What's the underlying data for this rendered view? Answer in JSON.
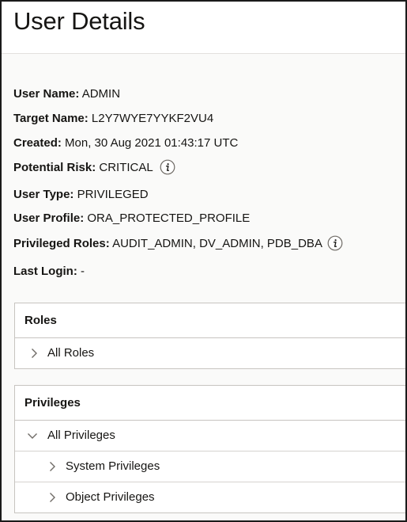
{
  "header": {
    "title": "User Details"
  },
  "details": {
    "user_name": {
      "label": "User Name:",
      "value": "ADMIN"
    },
    "target_name": {
      "label": "Target Name:",
      "value": "L2Y7WYE7YYKF2VU4"
    },
    "created": {
      "label": "Created:",
      "value": "Mon, 30 Aug 2021 01:43:17 UTC"
    },
    "potential_risk": {
      "label": "Potential Risk:",
      "value": "CRITICAL"
    },
    "user_type": {
      "label": "User Type:",
      "value": "PRIVILEGED"
    },
    "user_profile": {
      "label": "User Profile:",
      "value": "ORA_PROTECTED_PROFILE"
    },
    "privileged_roles": {
      "label": "Privileged Roles:",
      "value": "AUDIT_ADMIN, DV_ADMIN, PDB_DBA"
    },
    "last_login": {
      "label": "Last Login:",
      "value": "-"
    }
  },
  "roles_panel": {
    "title": "Roles",
    "items": [
      {
        "label": "All Roles",
        "expanded": false
      }
    ]
  },
  "privileges_panel": {
    "title": "Privileges",
    "items": [
      {
        "label": "All Privileges",
        "expanded": true
      },
      {
        "label": "System Privileges",
        "expanded": false
      },
      {
        "label": "Object Privileges",
        "expanded": false
      }
    ]
  },
  "icons": {
    "info": "info-icon",
    "collapsed": "chevron-right-icon",
    "expanded": "chevron-down-icon"
  },
  "colors": {
    "text": "#161513",
    "border": "#c7c4c0",
    "background": "#fafaf9",
    "icon": "#6f6b66"
  }
}
